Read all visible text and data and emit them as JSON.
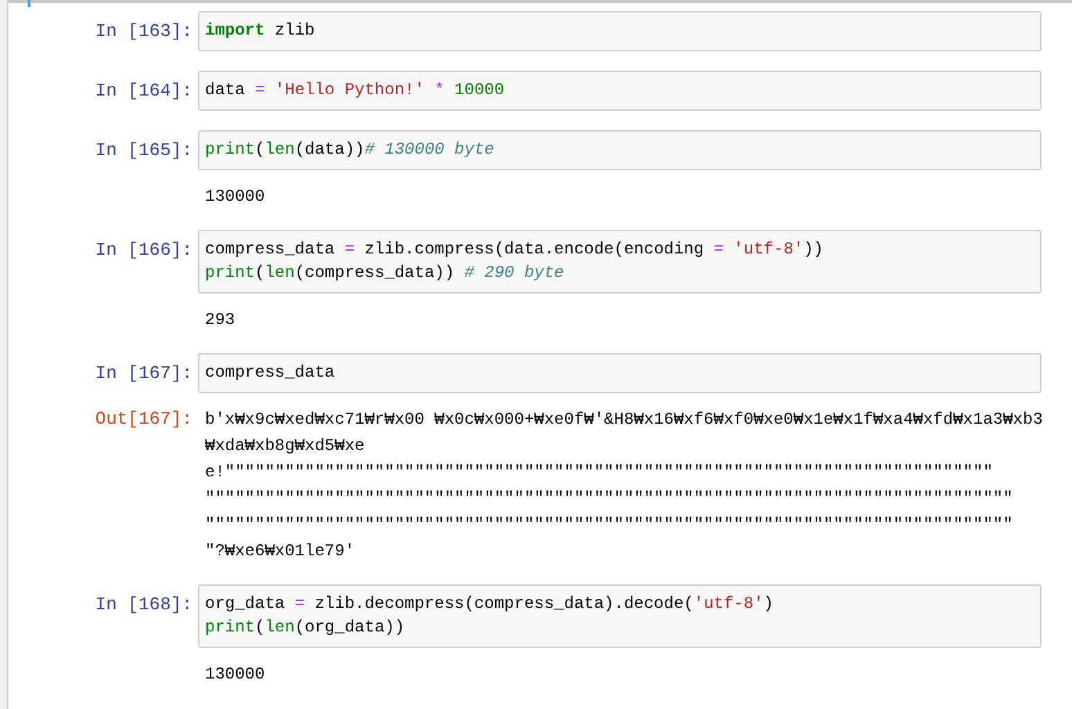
{
  "cells": [
    {
      "prompt": "In [163]:",
      "input": [
        [
          {
            "t": "import",
            "kind": "keyword"
          },
          {
            "t": " zlib",
            "kind": "plain"
          }
        ]
      ]
    },
    {
      "prompt": "In [164]:",
      "input": [
        [
          {
            "t": "data ",
            "kind": "plain"
          },
          {
            "t": "=",
            "kind": "operator"
          },
          {
            "t": " 'Hello Python!' ",
            "kind": "string"
          },
          {
            "t": "*",
            "kind": "operator"
          },
          {
            "t": " 10000",
            "kind": "number"
          }
        ]
      ]
    },
    {
      "prompt": "In [165]:",
      "input": [
        [
          {
            "t": "print",
            "kind": "builtin"
          },
          {
            "t": "(",
            "kind": "plain"
          },
          {
            "t": "len",
            "kind": "builtin"
          },
          {
            "t": "(data))",
            "kind": "plain"
          },
          {
            "t": "# 130000 byte",
            "kind": "comment"
          }
        ]
      ],
      "output": {
        "lines": [
          "130000"
        ]
      }
    },
    {
      "prompt": "In [166]:",
      "input": [
        [
          {
            "t": "compress_data ",
            "kind": "plain"
          },
          {
            "t": "=",
            "kind": "operator"
          },
          {
            "t": " zlib.compress(data.encode(encoding ",
            "kind": "plain"
          },
          {
            "t": "=",
            "kind": "operator"
          },
          {
            "t": " 'utf-8'",
            "kind": "string"
          },
          {
            "t": "))",
            "kind": "plain"
          }
        ],
        [
          {
            "t": "print",
            "kind": "builtin"
          },
          {
            "t": "(",
            "kind": "plain"
          },
          {
            "t": "len",
            "kind": "builtin"
          },
          {
            "t": "(compress_data)) ",
            "kind": "plain"
          },
          {
            "t": "# 290 byte",
            "kind": "comment"
          }
        ]
      ],
      "output": {
        "lines": [
          "293"
        ]
      }
    },
    {
      "prompt": "In [167]:",
      "input": [
        [
          {
            "t": "compress_data",
            "kind": "plain"
          }
        ]
      ],
      "output": {
        "prompt": "Out[167]:",
        "lines": [
          "b'x₩x9c₩xed₩xc71₩r₩x00 ₩x0c₩x000+₩xe0f₩'&H8₩x16₩xf6₩xf0₩xe0₩x1e₩x1f₩xa4₩xfd₩x1a3₩xb3",
          "₩xda₩xb8g₩xd5₩xe",
          "e!\"\"\"\"\"\"\"\"\"\"\"\"\"\"\"\"\"\"\"\"\"\"\"\"\"\"\"\"\"\"\"\"\"\"\"\"\"\"\"\"\"\"\"\"\"\"\"\"\"\"\"\"\"\"\"\"\"\"\"\"\"\"\"\"\"\"\"\"\"\"\"\"\"\"\"\"\"",
          "\"\"\"\"\"\"\"\"\"\"\"\"\"\"\"\"\"\"\"\"\"\"\"\"\"\"\"\"\"\"\"\"\"\"\"\"\"\"\"\"\"\"\"\"\"\"\"\"\"\"\"\"\"\"\"\"\"\"\"\"\"\"\"\"\"\"\"\"\"\"\"\"\"\"\"\"\"\"\"\"\"",
          "\"\"\"\"\"\"\"\"\"\"\"\"\"\"\"\"\"\"\"\"\"\"\"\"\"\"\"\"\"\"\"\"\"\"\"\"\"\"\"\"\"\"\"\"\"\"\"\"\"\"\"\"\"\"\"\"\"\"\"\"\"\"\"\"\"\"\"\"\"\"\"\"\"\"\"\"\"\"\"\"\"",
          "\"?₩xe6₩x01le79'"
        ]
      }
    },
    {
      "prompt": "In [168]:",
      "input": [
        [
          {
            "t": "org_data ",
            "kind": "plain"
          },
          {
            "t": "=",
            "kind": "operator"
          },
          {
            "t": " zlib.decompress(compress_data).decode(",
            "kind": "plain"
          },
          {
            "t": "'utf-8'",
            "kind": "string"
          },
          {
            "t": ")",
            "kind": "plain"
          }
        ],
        [
          {
            "t": "print",
            "kind": "builtin"
          },
          {
            "t": "(",
            "kind": "plain"
          },
          {
            "t": "len",
            "kind": "builtin"
          },
          {
            "t": "(org_data))",
            "kind": "plain"
          }
        ]
      ],
      "output": {
        "lines": [
          "130000"
        ]
      }
    }
  ]
}
